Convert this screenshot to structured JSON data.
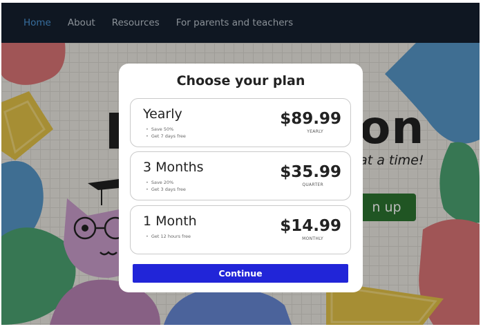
{
  "nav": {
    "items": [
      {
        "label": "Home",
        "active": true
      },
      {
        "label": "About",
        "active": false
      },
      {
        "label": "Resources",
        "active": false
      },
      {
        "label": "For parents and teachers",
        "active": false
      }
    ]
  },
  "hero": {
    "title_visible": "on",
    "tagline_visible": "d at a time!",
    "signup_visible": "n up"
  },
  "modal": {
    "title": "Choose your plan",
    "plans": [
      {
        "name": "Yearly",
        "perks": [
          "Save 50%",
          "Get 7 days free"
        ],
        "price": "$89.99",
        "period": "YEARLY"
      },
      {
        "name": "3 Months",
        "perks": [
          "Save 20%",
          "Get 3 days free"
        ],
        "price": "$35.99",
        "period": "QUARTER"
      },
      {
        "name": "1 Month",
        "perks": [
          "Get 12 hours free"
        ],
        "price": "$14.99",
        "period": "MONTHLY"
      }
    ],
    "continue_label": "Continue"
  },
  "colors": {
    "nav_bg": "#03101f",
    "nav_active": "#3e8fd6",
    "continue_bg": "#2125d8",
    "signup_bg": "#1c6b21"
  }
}
